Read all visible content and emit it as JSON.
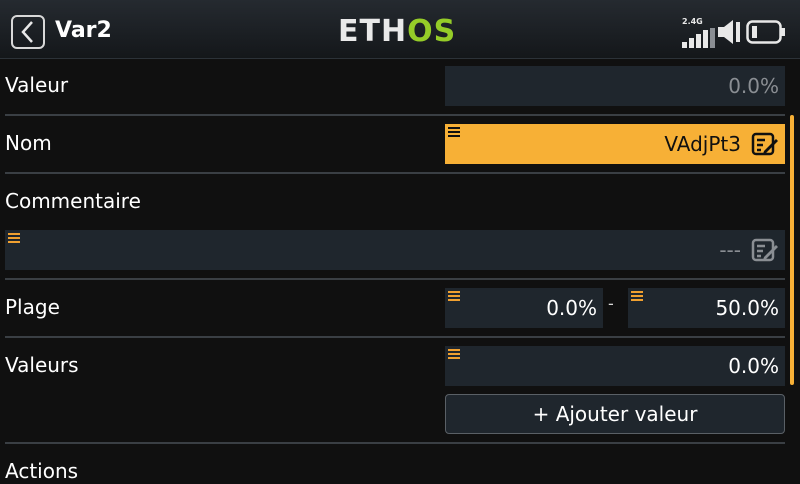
{
  "header": {
    "back_icon": "chevron-left-icon",
    "title": "Var2",
    "logo_left": "ETH",
    "logo_right": "OS",
    "signal_label": "2.4G",
    "icons": [
      "signal-bars-icon",
      "speaker-icon",
      "battery-icon"
    ]
  },
  "rows": {
    "valeur": {
      "label": "Valeur",
      "value": "0.0%"
    },
    "nom": {
      "label": "Nom",
      "value": "VAdjPt3"
    },
    "commentaire": {
      "label": "Commentaire",
      "value": "---"
    },
    "plage": {
      "label": "Plage",
      "min": "0.0%",
      "separator": "-",
      "max": "50.0%"
    },
    "valeurs": {
      "label": "Valeurs",
      "value": "0.0%",
      "add_button": "+ Ajouter valeur"
    },
    "actions": {
      "label": "Actions"
    }
  },
  "colors": {
    "accent": "#f7b036",
    "field_bg": "#1f262d",
    "logo_green": "#95cc28",
    "background": "#101010"
  }
}
